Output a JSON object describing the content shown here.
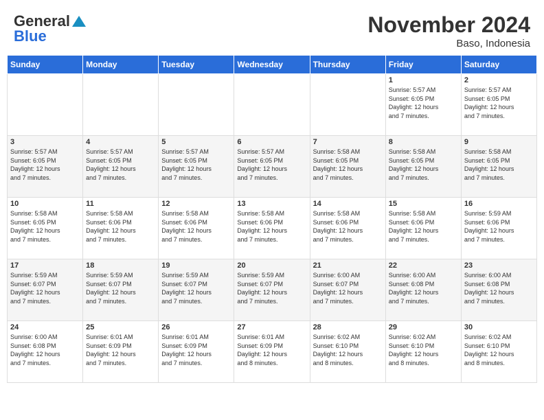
{
  "header": {
    "logo_general": "General",
    "logo_blue": "Blue",
    "month_title": "November 2024",
    "location": "Baso, Indonesia"
  },
  "weekdays": [
    "Sunday",
    "Monday",
    "Tuesday",
    "Wednesday",
    "Thursday",
    "Friday",
    "Saturday"
  ],
  "weeks": [
    [
      {
        "day": "",
        "info": ""
      },
      {
        "day": "",
        "info": ""
      },
      {
        "day": "",
        "info": ""
      },
      {
        "day": "",
        "info": ""
      },
      {
        "day": "",
        "info": ""
      },
      {
        "day": "1",
        "info": "Sunrise: 5:57 AM\nSunset: 6:05 PM\nDaylight: 12 hours\nand 7 minutes."
      },
      {
        "day": "2",
        "info": "Sunrise: 5:57 AM\nSunset: 6:05 PM\nDaylight: 12 hours\nand 7 minutes."
      }
    ],
    [
      {
        "day": "3",
        "info": "Sunrise: 5:57 AM\nSunset: 6:05 PM\nDaylight: 12 hours\nand 7 minutes."
      },
      {
        "day": "4",
        "info": "Sunrise: 5:57 AM\nSunset: 6:05 PM\nDaylight: 12 hours\nand 7 minutes."
      },
      {
        "day": "5",
        "info": "Sunrise: 5:57 AM\nSunset: 6:05 PM\nDaylight: 12 hours\nand 7 minutes."
      },
      {
        "day": "6",
        "info": "Sunrise: 5:57 AM\nSunset: 6:05 PM\nDaylight: 12 hours\nand 7 minutes."
      },
      {
        "day": "7",
        "info": "Sunrise: 5:58 AM\nSunset: 6:05 PM\nDaylight: 12 hours\nand 7 minutes."
      },
      {
        "day": "8",
        "info": "Sunrise: 5:58 AM\nSunset: 6:05 PM\nDaylight: 12 hours\nand 7 minutes."
      },
      {
        "day": "9",
        "info": "Sunrise: 5:58 AM\nSunset: 6:05 PM\nDaylight: 12 hours\nand 7 minutes."
      }
    ],
    [
      {
        "day": "10",
        "info": "Sunrise: 5:58 AM\nSunset: 6:05 PM\nDaylight: 12 hours\nand 7 minutes."
      },
      {
        "day": "11",
        "info": "Sunrise: 5:58 AM\nSunset: 6:06 PM\nDaylight: 12 hours\nand 7 minutes."
      },
      {
        "day": "12",
        "info": "Sunrise: 5:58 AM\nSunset: 6:06 PM\nDaylight: 12 hours\nand 7 minutes."
      },
      {
        "day": "13",
        "info": "Sunrise: 5:58 AM\nSunset: 6:06 PM\nDaylight: 12 hours\nand 7 minutes."
      },
      {
        "day": "14",
        "info": "Sunrise: 5:58 AM\nSunset: 6:06 PM\nDaylight: 12 hours\nand 7 minutes."
      },
      {
        "day": "15",
        "info": "Sunrise: 5:58 AM\nSunset: 6:06 PM\nDaylight: 12 hours\nand 7 minutes."
      },
      {
        "day": "16",
        "info": "Sunrise: 5:59 AM\nSunset: 6:06 PM\nDaylight: 12 hours\nand 7 minutes."
      }
    ],
    [
      {
        "day": "17",
        "info": "Sunrise: 5:59 AM\nSunset: 6:07 PM\nDaylight: 12 hours\nand 7 minutes."
      },
      {
        "day": "18",
        "info": "Sunrise: 5:59 AM\nSunset: 6:07 PM\nDaylight: 12 hours\nand 7 minutes."
      },
      {
        "day": "19",
        "info": "Sunrise: 5:59 AM\nSunset: 6:07 PM\nDaylight: 12 hours\nand 7 minutes."
      },
      {
        "day": "20",
        "info": "Sunrise: 5:59 AM\nSunset: 6:07 PM\nDaylight: 12 hours\nand 7 minutes."
      },
      {
        "day": "21",
        "info": "Sunrise: 6:00 AM\nSunset: 6:07 PM\nDaylight: 12 hours\nand 7 minutes."
      },
      {
        "day": "22",
        "info": "Sunrise: 6:00 AM\nSunset: 6:08 PM\nDaylight: 12 hours\nand 7 minutes."
      },
      {
        "day": "23",
        "info": "Sunrise: 6:00 AM\nSunset: 6:08 PM\nDaylight: 12 hours\nand 7 minutes."
      }
    ],
    [
      {
        "day": "24",
        "info": "Sunrise: 6:00 AM\nSunset: 6:08 PM\nDaylight: 12 hours\nand 7 minutes."
      },
      {
        "day": "25",
        "info": "Sunrise: 6:01 AM\nSunset: 6:09 PM\nDaylight: 12 hours\nand 7 minutes."
      },
      {
        "day": "26",
        "info": "Sunrise: 6:01 AM\nSunset: 6:09 PM\nDaylight: 12 hours\nand 7 minutes."
      },
      {
        "day": "27",
        "info": "Sunrise: 6:01 AM\nSunset: 6:09 PM\nDaylight: 12 hours\nand 8 minutes."
      },
      {
        "day": "28",
        "info": "Sunrise: 6:02 AM\nSunset: 6:10 PM\nDaylight: 12 hours\nand 8 minutes."
      },
      {
        "day": "29",
        "info": "Sunrise: 6:02 AM\nSunset: 6:10 PM\nDaylight: 12 hours\nand 8 minutes."
      },
      {
        "day": "30",
        "info": "Sunrise: 6:02 AM\nSunset: 6:10 PM\nDaylight: 12 hours\nand 8 minutes."
      }
    ]
  ]
}
